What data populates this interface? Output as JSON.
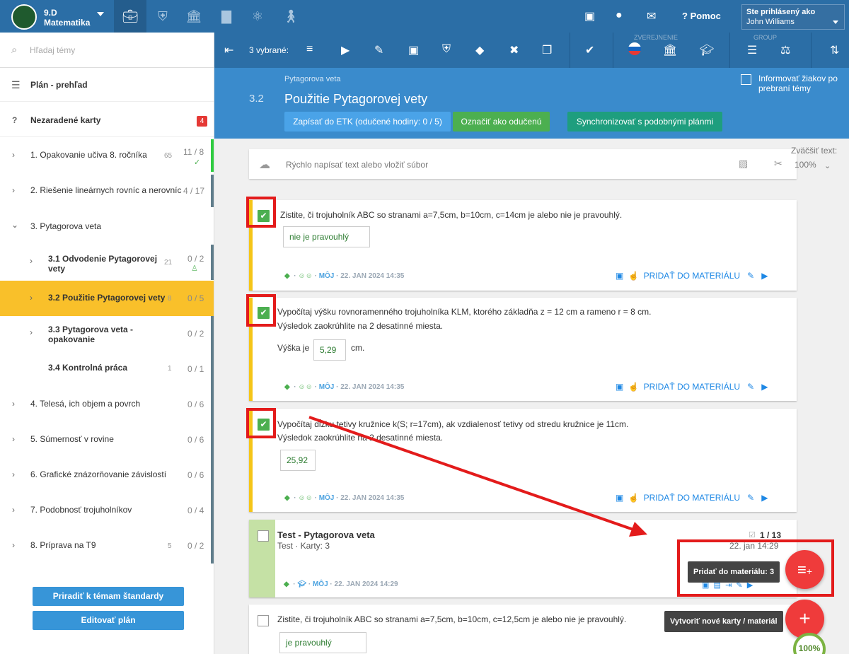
{
  "topbar": {
    "class_name": "9.D Matematika",
    "help": "Pomoc",
    "user_label": "Ste prihlásený ako",
    "user_name": "John Williams"
  },
  "sidebar": {
    "search_placeholder": "Hľadaj témy",
    "plan": "Plán - prehľad",
    "unassigned": "Nezaradené karty",
    "unassigned_badge": "4",
    "items": [
      {
        "label": "1. Opakovanie učiva 8. ročníka",
        "count": "65",
        "frac": "11 / 8"
      },
      {
        "label": "2. Riešenie lineárnych rovníc a nerovníc",
        "count": "",
        "frac": "4 / 17"
      },
      {
        "label": "3. Pytagorova veta",
        "count": "",
        "frac": ""
      },
      {
        "label": "3.1  Odvodenie Pytagorovej vety",
        "count": "21",
        "frac": "0 / 2"
      },
      {
        "label": "3.2  Použitie Pytagorovej vety",
        "count": "8",
        "frac": "0 / 5"
      },
      {
        "label": "3.3  Pytagorova veta - opakovanie",
        "count": "",
        "frac": "0 / 2"
      },
      {
        "label": "3.4  Kontrolná práca",
        "count": "1",
        "frac": "0 / 1"
      },
      {
        "label": "4. Telesá, ich objem a povrch",
        "count": "",
        "frac": "0 / 6"
      },
      {
        "label": "5. Súmernosť v rovine",
        "count": "",
        "frac": "0 / 6"
      },
      {
        "label": "6. Grafické znázorňovanie závislostí",
        "count": "",
        "frac": "0 / 6"
      },
      {
        "label": "7. Podobnosť trojuholníkov",
        "count": "",
        "frac": "0 / 4"
      },
      {
        "label": "8. Príprava na T9",
        "count": "5",
        "frac": "0 / 2"
      }
    ],
    "btn_assign": "Priradiť k témam štandardy",
    "btn_edit": "Editovať plán"
  },
  "toolbar": {
    "selected": "3 vybrané:",
    "cap_publish": "ZVEREJNENIE",
    "cap_group": "GROUP"
  },
  "header": {
    "breadcrumb": "Pytagorova veta",
    "number": "3.2",
    "title": "Použitie Pytagorovej vety",
    "btn_etk": "Zapísať do ETK (odučené hodiny: 0 / 5)",
    "btn_taught": "Označiť ako odučenú",
    "btn_sync": "Synchronizovať s podobnými plánmi",
    "inform": "Informovať žiakov po prebraní témy"
  },
  "main": {
    "quick_placeholder": "Rýchlo napísať text alebo vložiť súbor",
    "zoom_label": "Zväčšiť text:",
    "zoom_value": "100%",
    "cards": [
      {
        "line1": "Zistite, či trojuholník ABC so stranami a=7,5cm, b=10cm, c=14cm je alebo nie je pravouhlý.",
        "line2": "",
        "answer_prefix": "",
        "answer": "nie je pravouhlý",
        "answer_suffix": "",
        "date": "22. JAN 2024 14:35"
      },
      {
        "line1": "Vypočítaj výšku rovnoramenného trojuholníka KLM, ktorého základňa z = 12 cm a rameno r = 8 cm.",
        "line2": "Výsledok zaokrúhlite na 2 desatinné miesta.",
        "answer_prefix": "Výška je",
        "answer": "5,29",
        "answer_suffix": "cm.",
        "date": "22. JAN 2024 14:35"
      },
      {
        "line1": "Vypočítaj dĺžku tetivy kružnice k(S; r=17cm), ak vzdialenosť tetivy od stredu kružnice je 11cm.",
        "line2": "Výsledok zaokrúhlite na 2 desatinné miesta.",
        "answer_prefix": "",
        "answer": "25,92",
        "answer_suffix": "",
        "date": "22. JAN 2024 14:35"
      }
    ],
    "moj": "MÔJ",
    "add_to_material": "PRIDAŤ DO MATERIÁLU",
    "test": {
      "title": "Test - Pytagorova veta",
      "sub": "Test · Karty: 3",
      "count": "1 / 13",
      "date_right": "22. jan 14:29",
      "date": "22. JAN 2024 14:29"
    },
    "last_card": {
      "line1": "Zistite, či trojuholník ABC so stranami a=7,5cm, b=10cm, c=12,5cm je alebo nie je pravouhlý.",
      "answer": "je pravouhlý"
    },
    "fab_add_tooltip": "Pridať do materiálu: 3",
    "fab_new_tooltip": "Vytvoriť nové karty / materiál",
    "progress": "100%"
  }
}
